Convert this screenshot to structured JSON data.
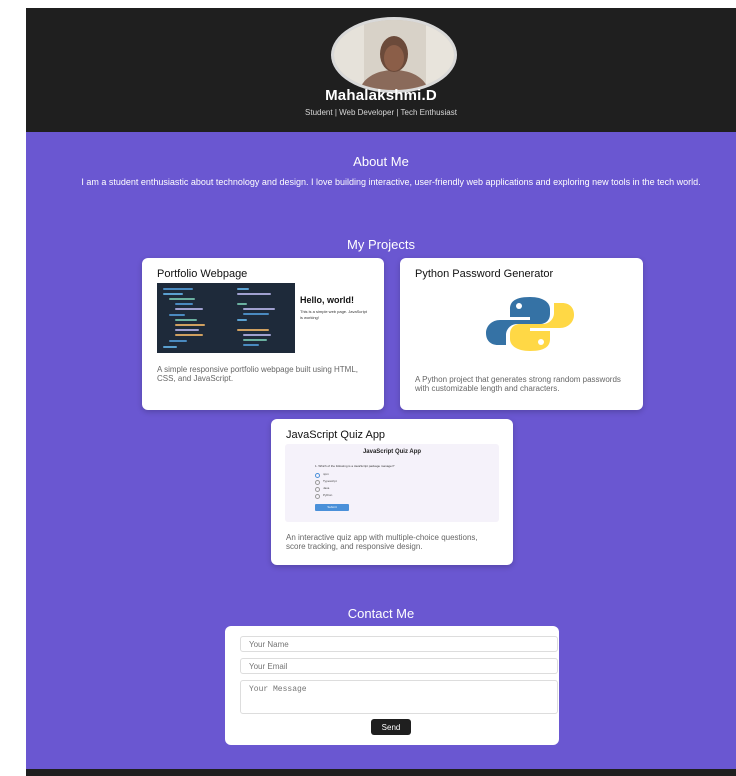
{
  "header": {
    "name": "Mahalakshmi.D",
    "tagline": "Student | Web Developer | Tech Enthusiast"
  },
  "about": {
    "title": "About Me",
    "text": "I am a student enthusiastic about technology and design. I love building interactive, user-friendly web applications and exploring new tools in the tech world."
  },
  "projects": {
    "title": "My Projects",
    "items": [
      {
        "title": "Portfolio Webpage",
        "description": "A simple responsive portfolio webpage built using HTML, CSS, and JavaScript.",
        "preview_heading": "Hello, world!",
        "preview_text": "This is a simple web page. JavaScript is working!"
      },
      {
        "title": "Python Password Generator",
        "description": "A Python project that generates strong random passwords with customizable length and characters."
      },
      {
        "title": "JavaScript Quiz App",
        "description": "An interactive quiz app with multiple-choice questions, score tracking, and responsive design.",
        "preview_heading": "JavaScript Quiz App",
        "preview_question": "1. Which of the following is a JavaScript package manager?",
        "preview_options": [
          "npm",
          "Typescript",
          "Java",
          "Python"
        ],
        "preview_submit": "Submit"
      }
    ]
  },
  "contact": {
    "title": "Contact Me",
    "name_placeholder": "Your Name",
    "email_placeholder": "Your Email",
    "message_placeholder": "Your Message",
    "send_label": "Send"
  },
  "colors": {
    "background": "#6a57d1",
    "header": "#1f1f1f",
    "python_blue": "#3572a5",
    "python_yellow": "#ffd845",
    "quiz_button": "#4a90d9"
  }
}
